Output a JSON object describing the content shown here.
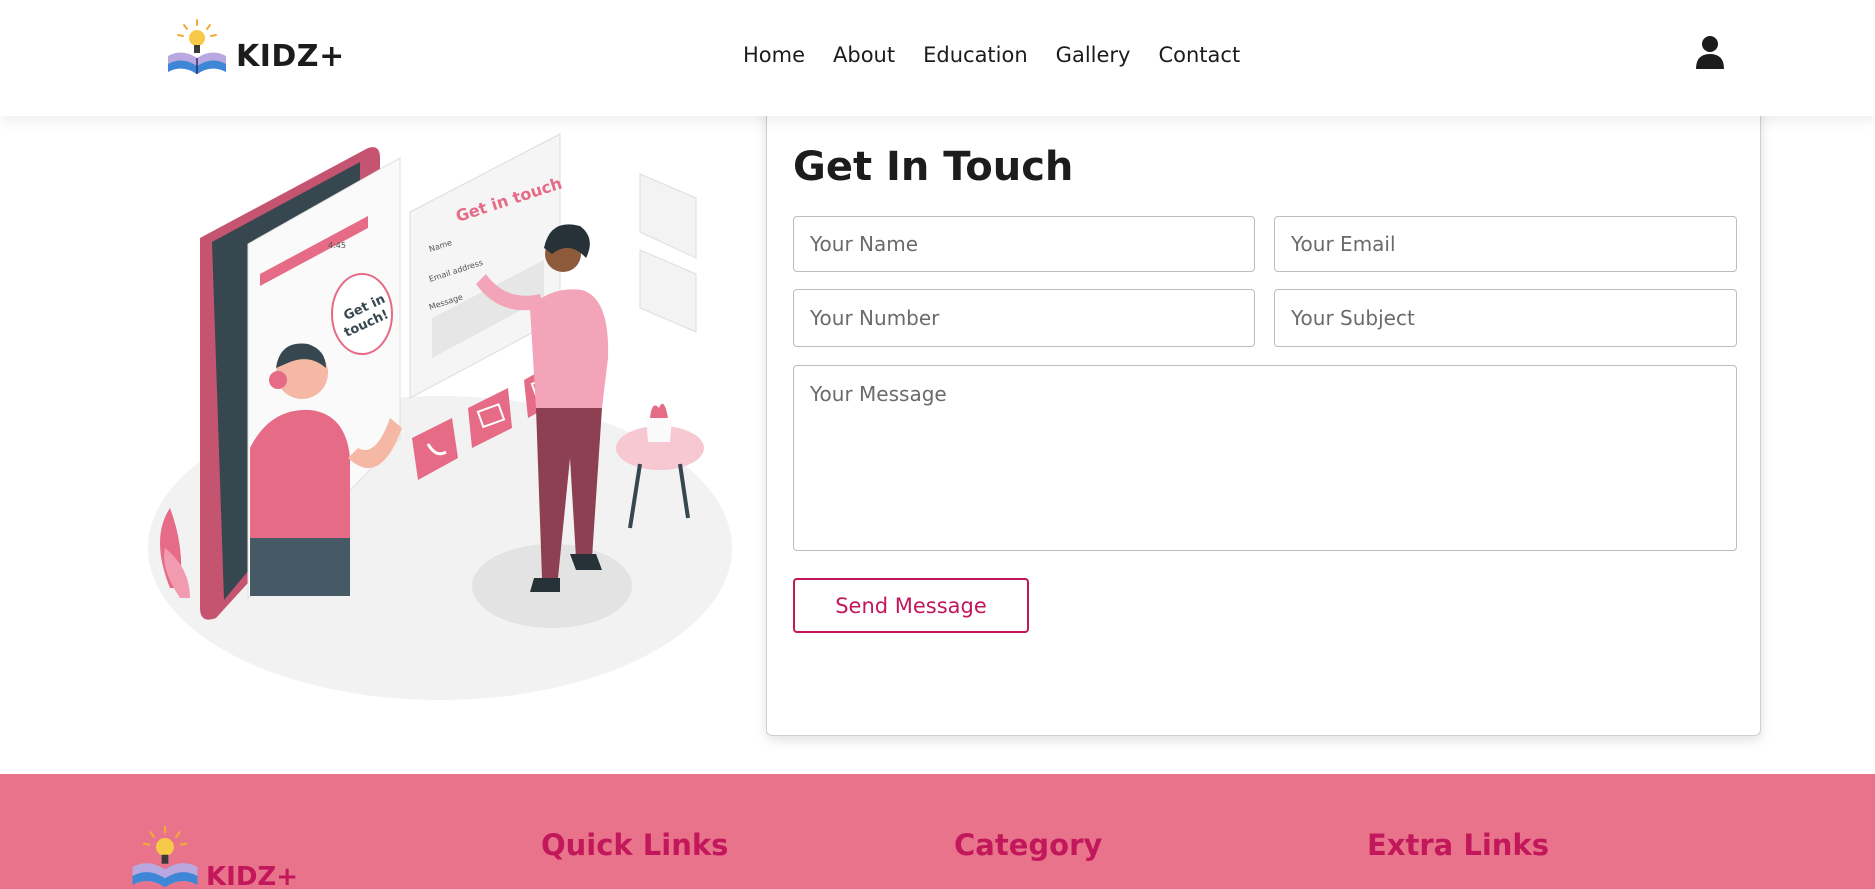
{
  "header": {
    "brand": "KIDZ+",
    "nav": [
      "Home",
      "About",
      "Education",
      "Gallery",
      "Contact"
    ],
    "user_icon": "user-icon"
  },
  "contact": {
    "title": "Get In Touch",
    "fields": {
      "name_placeholder": "Your Name",
      "email_placeholder": "Your Email",
      "number_placeholder": "Your Number",
      "subject_placeholder": "Your Subject",
      "message_placeholder": "Your Message"
    },
    "send_label": "Send Message",
    "illustration": {
      "panel_heading": "Get in touch",
      "panel_fields": [
        "Name",
        "Email address",
        "Message"
      ],
      "speech_bubble": "Get in touch!",
      "phone_time": "4:45"
    }
  },
  "footer": {
    "brand": "KIDZ+",
    "headings": {
      "quick_links": "Quick Links",
      "category": "Category",
      "extra_links": "Extra Links"
    }
  },
  "colors": {
    "accent": "#c2185b",
    "footer_bg": "#e8738a",
    "illustration_pink": "#e56b86"
  }
}
